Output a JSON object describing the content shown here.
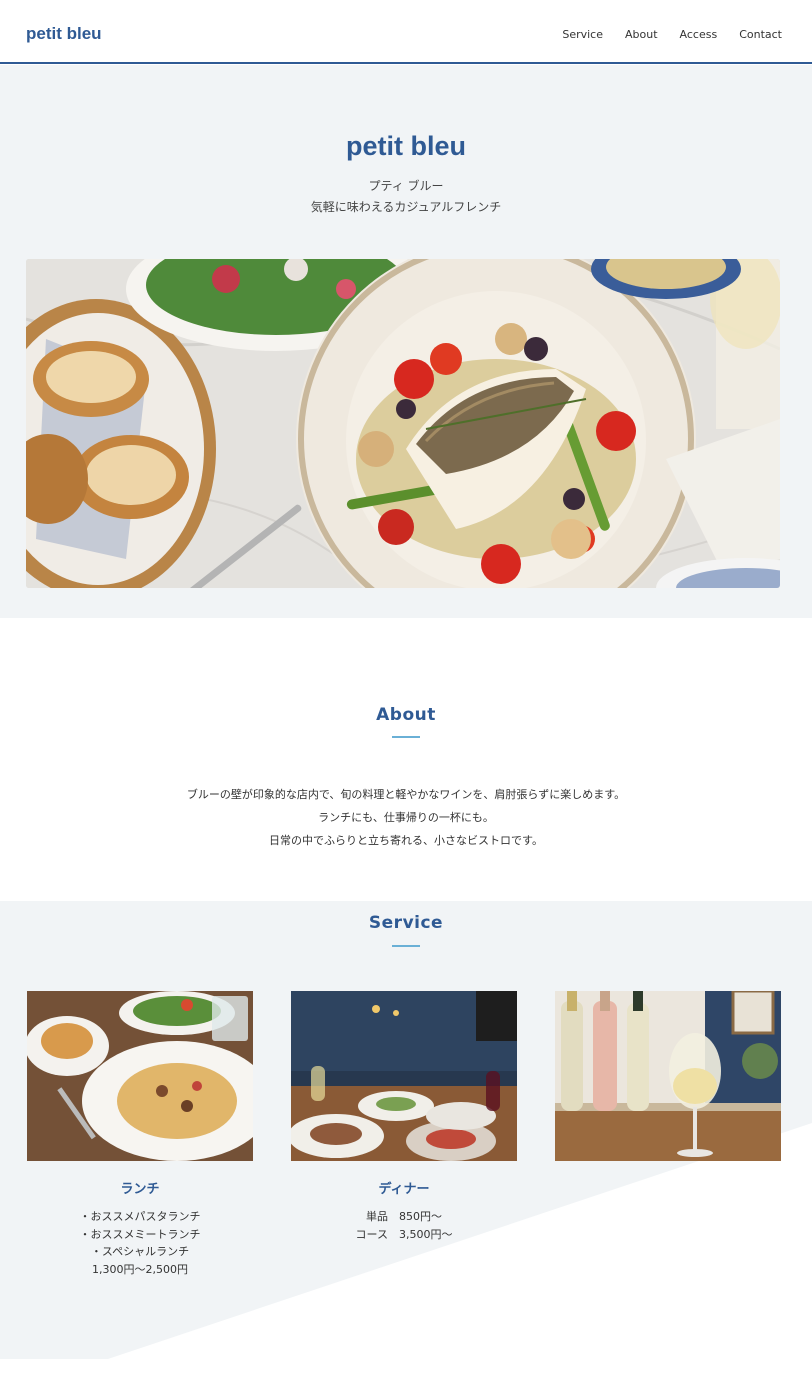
{
  "header": {
    "logo": "petit bleu",
    "nav": [
      "Service",
      "About",
      "Access",
      "Contact"
    ]
  },
  "hero": {
    "title": "petit bleu",
    "kana": "プティ ブルー",
    "tagline": "気軽に味わえるカジュアルフレンチ",
    "image_alt": "fish dish with bread, salad and wine"
  },
  "about": {
    "title": "About",
    "lines": [
      "ブルーの壁が印象的な店内で、旬の料理と軽やかなワインを、肩肘張らずに楽しめます。",
      "ランチにも、仕事帰りの一杯にも。",
      "日常の中でふらりと立ち寄れる、小さなビストロです。"
    ]
  },
  "service": {
    "title": "Service",
    "cards": [
      {
        "title": "ランチ",
        "lines": [
          "・おススメパスタランチ",
          "・おススメミートランチ",
          "・スペシャルランチ",
          "1,300円〜2,500円"
        ]
      },
      {
        "title": "ディナー",
        "lines": [
          "単品　850円〜",
          "コース　3,500円〜"
        ]
      },
      {
        "title": "",
        "lines": []
      }
    ]
  },
  "colors": {
    "brand": "#2f5a94",
    "accent_rule": "#6ab0d6",
    "section_bg": "#f1f4f6"
  }
}
